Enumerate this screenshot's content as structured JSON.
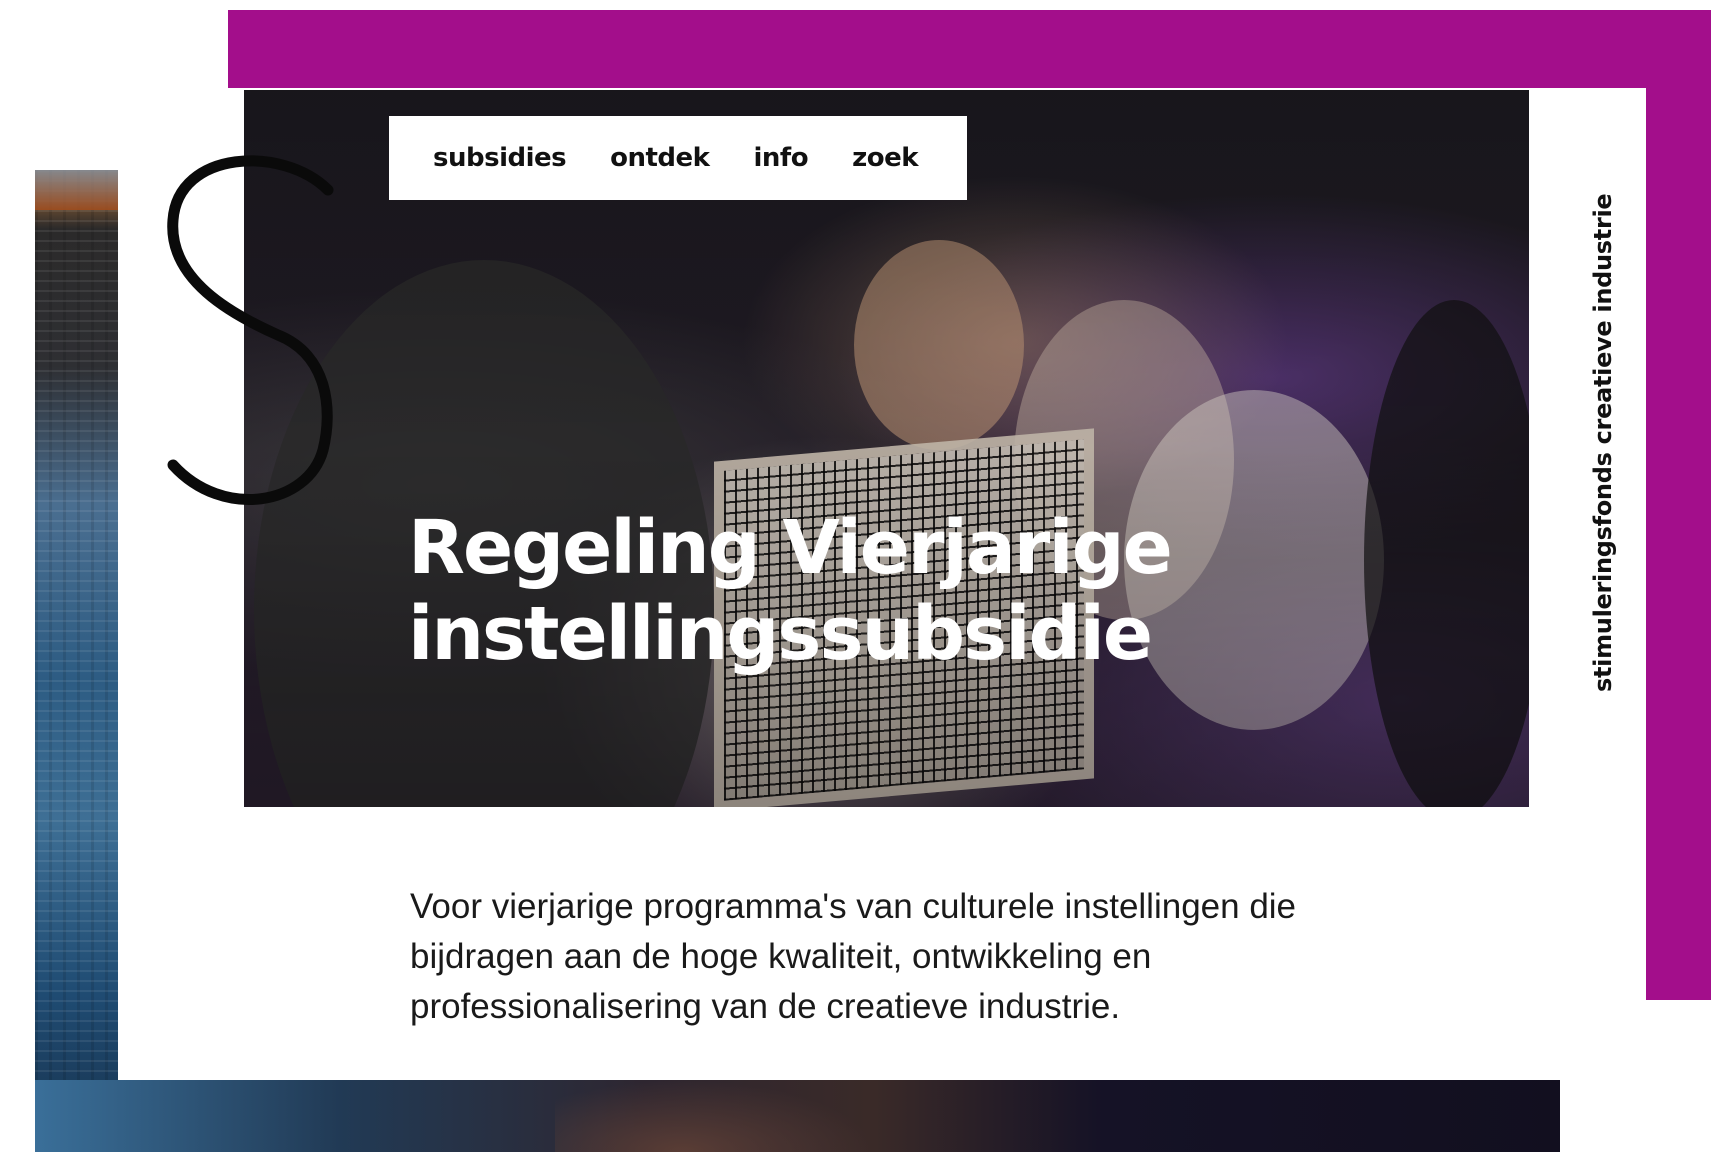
{
  "nav": {
    "items": [
      {
        "label": "subsidies"
      },
      {
        "label": "ontdek"
      },
      {
        "label": "info"
      },
      {
        "label": "zoek"
      }
    ]
  },
  "hero": {
    "title_line1": "Regeling Vierjarige",
    "title_line2": "instellingssubsidie"
  },
  "brand": {
    "vertical_text": "stimuleringsfonds creatieve industrie"
  },
  "intro": {
    "text": "Voor vierjarige programma's van culturele instellingen die bijdragen aan de hoge kwaliteit, ontwikkeling en professionalisering van de creatieve industrie."
  },
  "colors": {
    "accent": "#a30e8b",
    "text": "#111111",
    "background": "#ffffff"
  },
  "icons": {
    "logo": "s-logo-icon"
  }
}
